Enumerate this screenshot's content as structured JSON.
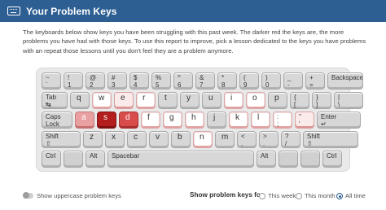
{
  "header": {
    "title": "Your Problem Keys",
    "icon": "keyboard-icon"
  },
  "description": "The keyboards below show keys you have been struggling with this past week. The darker red the keys are, the more problems you have had with those keys. To use this report to improve, pick a lesson dedicated to the keys you have problems with an repeat those lessons until you don't feel they are a problem anymore.",
  "heat_colors": {
    "0": "#d7d7d7",
    "1": "#ffffff",
    "2": "#fbeaea",
    "3": "#e8a0a0",
    "4": "#d94c4c",
    "5": "#b31d1d"
  },
  "keyboard": {
    "rows": [
      [
        {
          "id": "backtick",
          "label": "~\n`",
          "heat": 0
        },
        {
          "id": "1",
          "label": "!\n1",
          "heat": 0
        },
        {
          "id": "2",
          "label": "@\n2",
          "heat": 0
        },
        {
          "id": "3",
          "label": "#\n3",
          "heat": 0
        },
        {
          "id": "4",
          "label": "$\n4",
          "heat": 0
        },
        {
          "id": "5",
          "label": "%\n5",
          "heat": 0
        },
        {
          "id": "6",
          "label": "^\n6",
          "heat": 0
        },
        {
          "id": "7",
          "label": "&\n7",
          "heat": 0
        },
        {
          "id": "8",
          "label": "*\n8",
          "heat": 0
        },
        {
          "id": "9",
          "label": "(\n9",
          "heat": 0
        },
        {
          "id": "0",
          "label": ")\n0",
          "heat": 0
        },
        {
          "id": "minus",
          "label": "_\n-",
          "heat": 0
        },
        {
          "id": "equals",
          "label": "+\n=",
          "heat": 0
        },
        {
          "id": "backspace",
          "label": "Backspace",
          "heat": 0
        }
      ],
      [
        {
          "id": "tab",
          "label": "Tab\n↹",
          "heat": 0
        },
        {
          "id": "q",
          "label": "q",
          "heat": 0
        },
        {
          "id": "w",
          "label": "w",
          "heat": 1
        },
        {
          "id": "e",
          "label": "e",
          "heat": 2
        },
        {
          "id": "r",
          "label": "r",
          "heat": 1
        },
        {
          "id": "t",
          "label": "t",
          "heat": 0
        },
        {
          "id": "y",
          "label": "y",
          "heat": 0
        },
        {
          "id": "u",
          "label": "u",
          "heat": 0
        },
        {
          "id": "i",
          "label": "i",
          "heat": 1
        },
        {
          "id": "o",
          "label": "o",
          "heat": 1
        },
        {
          "id": "p",
          "label": "p",
          "heat": 0
        },
        {
          "id": "lbracket",
          "label": "{\n[",
          "heat": 0
        },
        {
          "id": "rbracket",
          "label": "}\n]",
          "heat": 0
        },
        {
          "id": "backslash",
          "label": "|\n\\",
          "heat": 0
        }
      ],
      [
        {
          "id": "caps",
          "label": "Caps\nLock",
          "heat": 0
        },
        {
          "id": "a",
          "label": "a",
          "heat": 3
        },
        {
          "id": "s",
          "label": "s",
          "heat": 5
        },
        {
          "id": "d",
          "label": "d",
          "heat": 4
        },
        {
          "id": "f",
          "label": "f",
          "heat": 1
        },
        {
          "id": "g",
          "label": "g",
          "heat": 1
        },
        {
          "id": "h",
          "label": "h",
          "heat": 1
        },
        {
          "id": "j",
          "label": "j",
          "heat": 0
        },
        {
          "id": "k",
          "label": "k",
          "heat": 1
        },
        {
          "id": "l",
          "label": "l",
          "heat": 1
        },
        {
          "id": "semicolon",
          "label": ":\n;",
          "heat": 1
        },
        {
          "id": "quote",
          "label": "\"\n'",
          "heat": 2
        },
        {
          "id": "enter",
          "label": "Enter\n↵",
          "heat": 0
        }
      ],
      [
        {
          "id": "lshift",
          "label": "Shift\n⇧",
          "heat": 0
        },
        {
          "id": "z",
          "label": "z",
          "heat": 0
        },
        {
          "id": "x",
          "label": "x",
          "heat": 0
        },
        {
          "id": "c",
          "label": "c",
          "heat": 0
        },
        {
          "id": "v",
          "label": "v",
          "heat": 0
        },
        {
          "id": "b",
          "label": "b",
          "heat": 0
        },
        {
          "id": "n",
          "label": "n",
          "heat": 1
        },
        {
          "id": "m",
          "label": "m",
          "heat": 0
        },
        {
          "id": "comma",
          "label": "<\n,",
          "heat": 0
        },
        {
          "id": "period",
          "label": ">\n.",
          "heat": 0
        },
        {
          "id": "slash",
          "label": "?\n/",
          "heat": 0
        },
        {
          "id": "rshift",
          "label": "Shift\n⇧",
          "heat": 0
        }
      ],
      [
        {
          "id": "lctrl",
          "label": "Ctrl",
          "heat": 0
        },
        {
          "id": "lwin",
          "label": "",
          "heat": 0
        },
        {
          "id": "lalt",
          "label": "Alt",
          "heat": 0
        },
        {
          "id": "space",
          "label": "Spacebar",
          "heat": 0
        },
        {
          "id": "ralt",
          "label": "Alt",
          "heat": 0
        },
        {
          "id": "rwin",
          "label": "",
          "heat": 0
        },
        {
          "id": "menu",
          "label": "",
          "heat": 0
        },
        {
          "id": "rctrl",
          "label": "Ctrl",
          "heat": 0
        }
      ]
    ]
  },
  "footer": {
    "toggle_label": "Show uppercase problem keys",
    "show_label": "Show problem keys for",
    "options": [
      {
        "label": "This week",
        "selected": false
      },
      {
        "label": "This month",
        "selected": false
      },
      {
        "label": "All time",
        "selected": true
      }
    ]
  }
}
